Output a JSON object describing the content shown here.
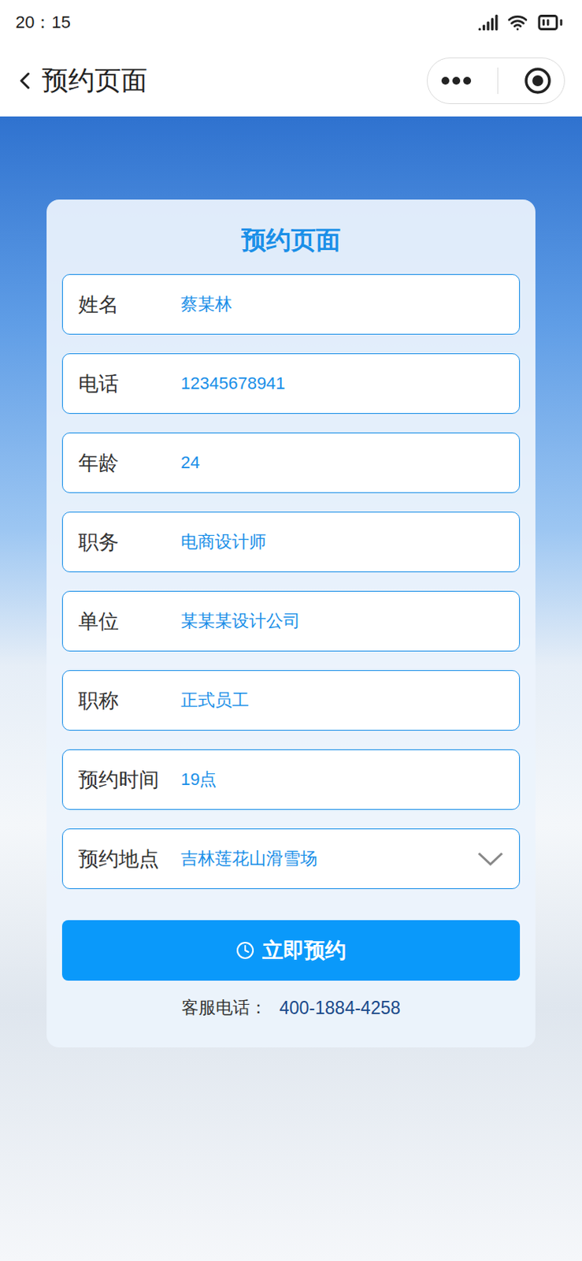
{
  "status_bar": {
    "time": "20：15"
  },
  "nav": {
    "title": "预约页面"
  },
  "card": {
    "title": "预约页面"
  },
  "fields": [
    {
      "label": "姓名",
      "value": "蔡某林",
      "kind": "text"
    },
    {
      "label": "电话",
      "value": "12345678941",
      "kind": "text"
    },
    {
      "label": "年龄",
      "value": "24",
      "kind": "text"
    },
    {
      "label": "职务",
      "value": "电商设计师",
      "kind": "text"
    },
    {
      "label": "单位",
      "value": "某某某设计公司",
      "kind": "text"
    },
    {
      "label": "职称",
      "value": "正式员工",
      "kind": "text"
    },
    {
      "label": "预约时间",
      "value": "19点",
      "kind": "text"
    },
    {
      "label": "预约地点",
      "value": "吉林莲花山滑雪场",
      "kind": "select"
    }
  ],
  "button": {
    "label": "立即预约"
  },
  "service": {
    "label": "客服电话：",
    "phone": "400-1884-4258"
  }
}
